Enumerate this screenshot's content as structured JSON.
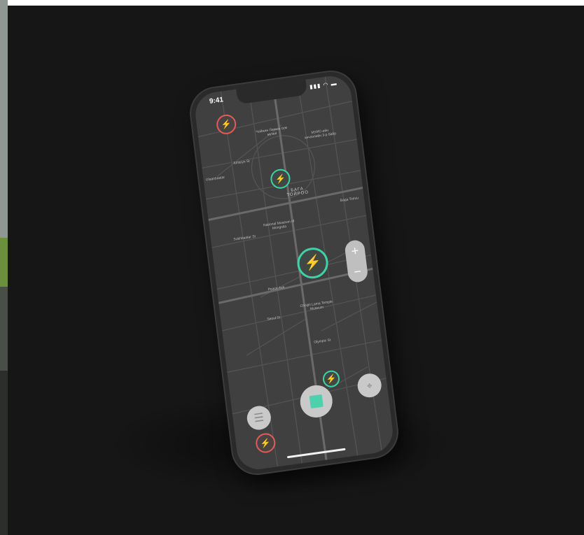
{
  "status": {
    "time": "9:41",
    "icons": "▮▮▮ ◠ ▬"
  },
  "map": {
    "labels": [
      {
        "text": "Чойжин Ламын сүм музей",
        "id": "choijin"
      },
      {
        "text": "МУИС-ийн хичээлийн 3-р байр",
        "id": "muis"
      },
      {
        "text": "Ulaanbaatar",
        "id": "ub"
      },
      {
        "text": "National Museum of Mongolia",
        "id": "museum"
      },
      {
        "text": "Choijin Lama Temple Museum",
        "id": "choijin-en"
      },
      {
        "text": "Peace Ave",
        "id": "peace"
      },
      {
        "text": "Seoul St",
        "id": "seoul"
      },
      {
        "text": "Olympic St",
        "id": "olympic"
      },
      {
        "text": "Baga Toiruu",
        "id": "toiruu-e"
      },
      {
        "text": "Amaryn St",
        "id": "amar"
      },
      {
        "text": "Sukhbaatar St",
        "id": "sukhbaatar"
      }
    ],
    "district": "БАГА ТОЙРОО"
  },
  "zoom": {
    "plus": "+",
    "minus": "−"
  },
  "buttons": {
    "menu_icon": "menu-icon",
    "scan_icon": "qr-icon",
    "locate_icon": "locate-icon"
  },
  "colors": {
    "available": "#3fd2a8",
    "busy": "#e25c55"
  }
}
